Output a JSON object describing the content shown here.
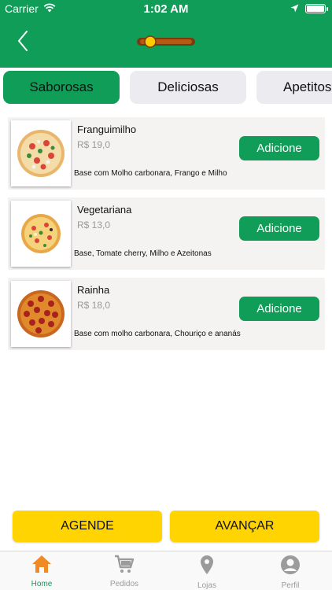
{
  "status_bar": {
    "carrier": "Carrier",
    "time": "1:02 AM"
  },
  "header": {
    "back_icon": "chevron-left-icon",
    "logo": "brand-logo",
    "color": "#0f9d58"
  },
  "tabs": [
    {
      "label": "Saborosas",
      "active": true
    },
    {
      "label": "Deliciosas",
      "active": false
    },
    {
      "label": "Apetitos",
      "active": false
    }
  ],
  "products": [
    {
      "name": "Franguimilho",
      "price": "R$ 19,0",
      "description": "Base com Molho carbonara, Frango e Milho",
      "button": "Adicione"
    },
    {
      "name": "Vegetariana",
      "price": "R$ 13,0",
      "description": "Base, Tomate cherry, Milho e Azeitonas",
      "button": "Adicione"
    },
    {
      "name": "Rainha",
      "price": "R$ 18,0",
      "description": "Base com molho carbonara, Chouriço e ananás",
      "button": "Adicione"
    }
  ],
  "actions": {
    "schedule": "AGENDE",
    "next": "AVANÇAR",
    "color": "#ffd400"
  },
  "tabbar": [
    {
      "label": "Home",
      "icon": "home-icon",
      "active": true
    },
    {
      "label": "Pedidos",
      "icon": "cart-icon",
      "active": false
    },
    {
      "label": "Lojas",
      "icon": "location-pin-icon",
      "active": false
    },
    {
      "label": "Perfil",
      "icon": "user-icon",
      "active": false
    }
  ]
}
